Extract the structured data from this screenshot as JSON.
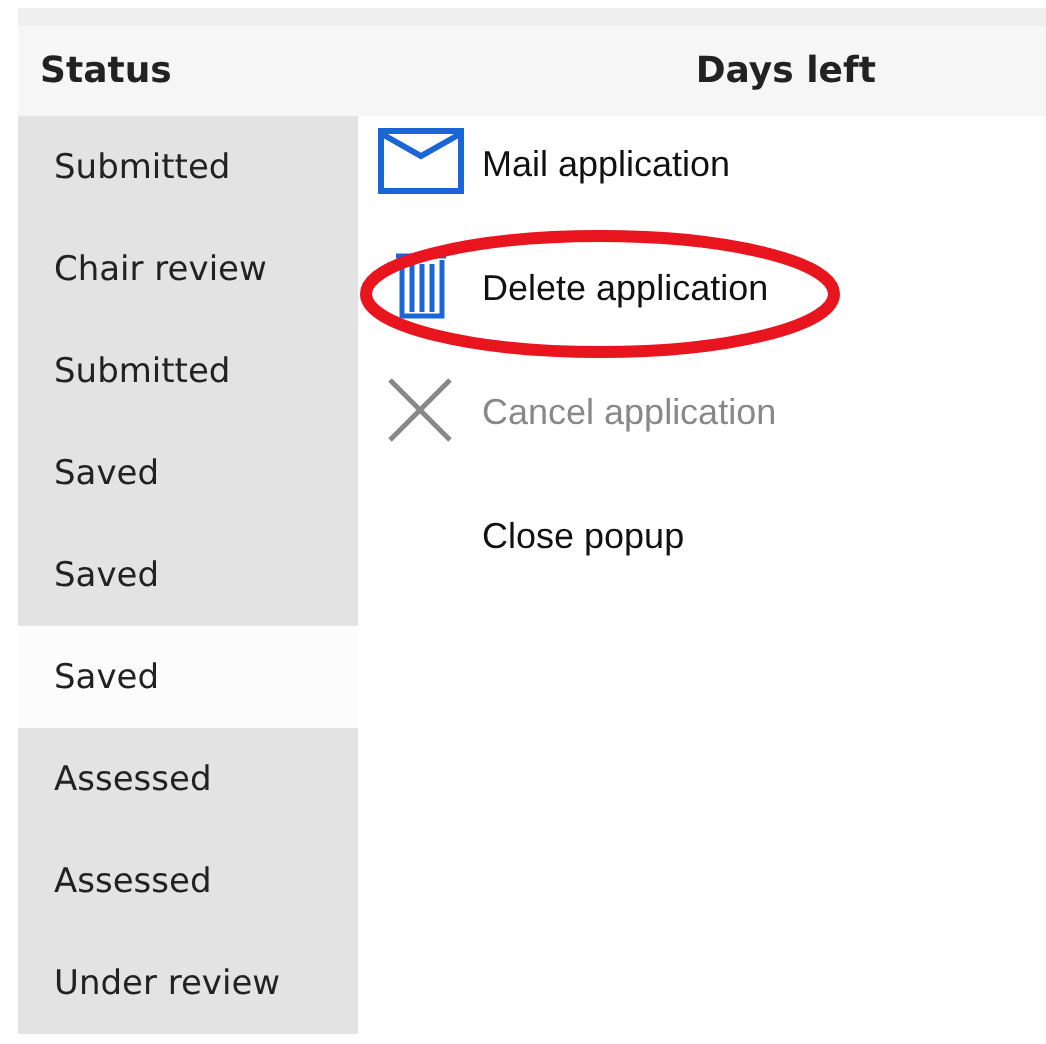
{
  "table": {
    "columns": [
      "Status",
      "Days left"
    ],
    "rows": [
      {
        "status": "Submitted",
        "selected": false
      },
      {
        "status": "Chair review",
        "selected": false
      },
      {
        "status": "Submitted",
        "selected": false
      },
      {
        "status": "Saved",
        "selected": false
      },
      {
        "status": "Saved",
        "selected": false
      },
      {
        "status": "Saved",
        "selected": true
      },
      {
        "status": "Assessed",
        "selected": false
      },
      {
        "status": "Assessed",
        "selected": false
      },
      {
        "status": "Under review",
        "selected": false
      }
    ]
  },
  "popup_menu": {
    "items": [
      {
        "kind": "mail",
        "label": "Mail application",
        "disabled": false,
        "circled": false
      },
      {
        "kind": "delete",
        "label": "Delete application",
        "disabled": false,
        "circled": true
      },
      {
        "kind": "cancel",
        "label": "Cancel application",
        "disabled": true,
        "circled": false
      },
      {
        "kind": "none",
        "label": "Close popup",
        "disabled": false,
        "circled": false
      }
    ]
  }
}
